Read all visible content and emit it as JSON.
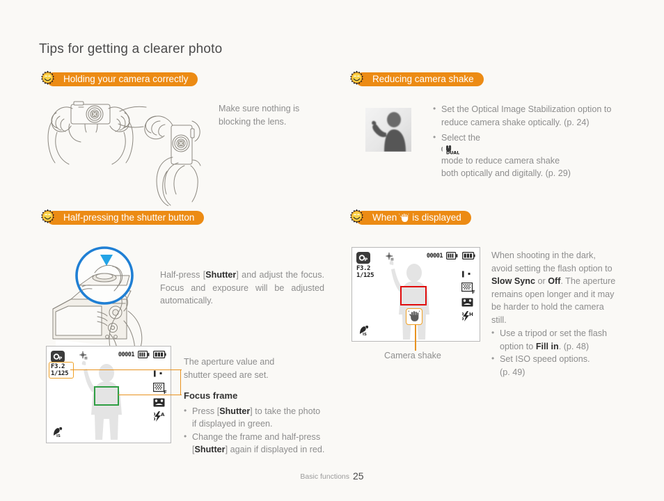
{
  "page": {
    "title": "Tips for getting a clearer photo",
    "footer_label": "Basic functions",
    "footer_page": "25",
    "accent_color": "#ec8b14",
    "background_color": "#faf9f6"
  },
  "sections": {
    "holding": {
      "heading": "Holding your camera correctly",
      "icon": "smiley-sun-icon",
      "note": "Make sure nothing is\nblocking the lens.",
      "note_line1": "Make sure nothing is",
      "note_line2": "blocking the lens.",
      "illustration_name": "hands-holding-camera-illustration"
    },
    "shake": {
      "heading": "Reducing camera shake",
      "icon": "smiley-sun-icon",
      "thumbnail_name": "blurred-person-photo",
      "bullets": [
        {
          "text_before": "Set the Optical Image Stabilization option to reduce camera shake optically. (p. 24)",
          "line1": "Set the Optical Image Stabilization option to",
          "line2": "reduce camera shake optically. (p. 24)"
        },
        {
          "line1_pre": "Select the ",
          "icon": "dual-is-icon",
          "icon_label": "DUAL",
          "line1_post": " mode to reduce camera shake",
          "line2": "both optically and digitally. (p. 29)"
        }
      ]
    },
    "halfpress": {
      "heading": "Half-pressing the shutter button",
      "icon": "smiley-sun-icon",
      "illustration_name": "camera-with-finger-on-shutter-illustration",
      "zoom_circle_name": "blue-zoom-circle-callout",
      "arrow_name": "blue-down-arrow-icon",
      "body": {
        "line1_a": "Half-press [",
        "line1_b": "Shutter",
        "line1_c": "] and adjust the focus.",
        "line2": "Focus and exposure will be adjusted",
        "line3": "automatically."
      },
      "callout_aperture_line1": "The aperture value and",
      "callout_aperture_line2": "shutter speed are set.",
      "focus_frame_title": "Focus frame",
      "focus_bullets": [
        {
          "pre": "Press [",
          "bold": "Shutter",
          "post": "] to take the photo",
          "line2": "if displayed in green."
        },
        {
          "pre": "Change the frame and half-press",
          "line2_pre": "[",
          "line2_bold": "Shutter",
          "line2_post": "] again if displayed in red."
        }
      ],
      "lcd": {
        "mode_label": "P",
        "aperture": "F3.2",
        "shutter": "1/125",
        "counter": "00001",
        "icons": [
          "af-frame-icon",
          "memory-card-icon",
          "battery-icon",
          "exposure-bar-icon",
          "face-detect-icon",
          "photo-size-icon",
          "flash-icon",
          "macro-icon"
        ],
        "focus_frame_color": "#2f9e43"
      }
    },
    "handshake": {
      "heading_pre": "When",
      "heading_icon": "shaking-hand-icon",
      "heading_post": "is displayed",
      "heading_plain": "When  is displayed",
      "icon": "smiley-sun-icon",
      "caption": "Camera shake",
      "lcd": {
        "mode_label": "P",
        "aperture": "F3.2",
        "shutter": "1/125",
        "counter": "00001",
        "focus_frame_color": "#e00c0c"
      },
      "body": {
        "l1": "When shooting in the dark,",
        "l2": "avoid setting the flash option to",
        "l3_b1": "Slow Sync",
        "l3_mid": " or ",
        "l3_b2": "Off",
        "l3_post": ". The aperture",
        "l4": "remains open longer and it may",
        "l5": "be harder to hold the camera",
        "l6": "still."
      },
      "bullets": [
        {
          "line1": "Use a tripod or set the flash",
          "line2_pre": "option to ",
          "line2_bold": "Fill in",
          "line2_post": ". (p. 48)"
        },
        {
          "line1": "Set ISO speed options.",
          "line2": "(p. 49)"
        }
      ]
    }
  }
}
